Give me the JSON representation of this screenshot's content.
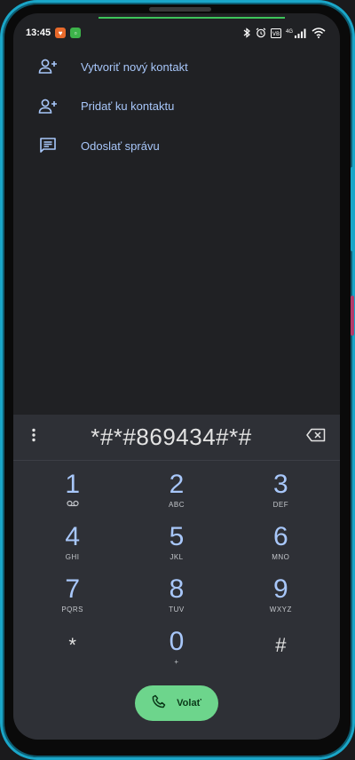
{
  "status": {
    "time": "13:45",
    "network_label": "4G"
  },
  "actions": [
    {
      "label": "Vytvoriť nový kontakt",
      "icon": "person-add-icon"
    },
    {
      "label": "Pridať ku kontaktu",
      "icon": "person-add-icon"
    },
    {
      "label": "Odoslať správu",
      "icon": "message-icon"
    }
  ],
  "dialpad": {
    "digits": "*#*#869434#*#",
    "keys": [
      {
        "digit": "1",
        "sub": ""
      },
      {
        "digit": "2",
        "sub": "ABC"
      },
      {
        "digit": "3",
        "sub": "DEF"
      },
      {
        "digit": "4",
        "sub": "GHI"
      },
      {
        "digit": "5",
        "sub": "JKL"
      },
      {
        "digit": "6",
        "sub": "MNO"
      },
      {
        "digit": "7",
        "sub": "PQRS"
      },
      {
        "digit": "8",
        "sub": "TUV"
      },
      {
        "digit": "9",
        "sub": "WXYZ"
      },
      {
        "digit": "*",
        "sub": ""
      },
      {
        "digit": "0",
        "sub": "+"
      },
      {
        "digit": "#",
        "sub": ""
      }
    ],
    "call_label": "Volať"
  },
  "colors": {
    "accent": "#a8c7fa",
    "call_button": "#6dd58c",
    "bezel": "#1aa6c8"
  }
}
